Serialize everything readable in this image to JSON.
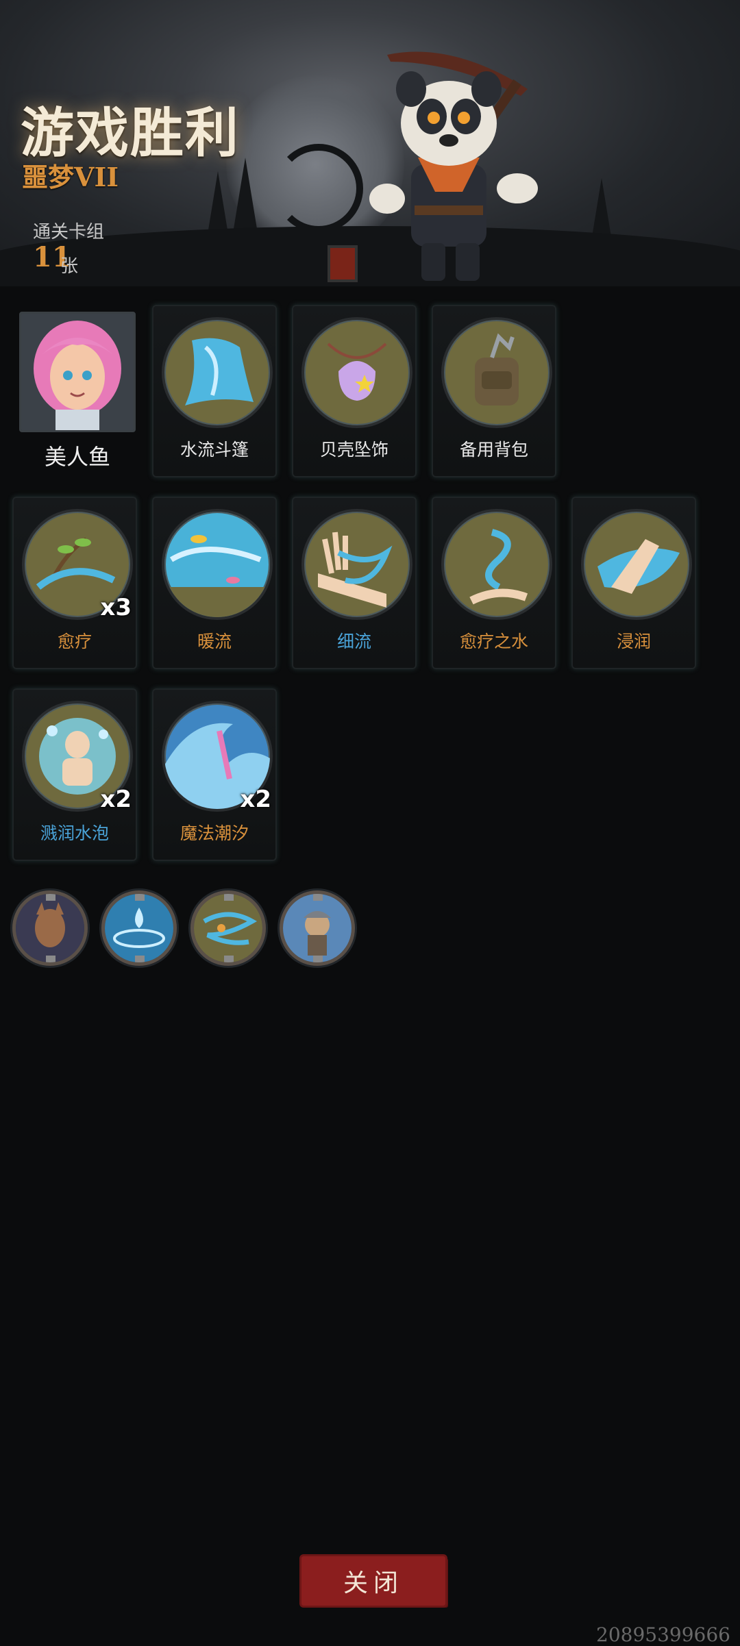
{
  "header": {
    "title": "游戏胜利",
    "difficulty": "噩梦VII",
    "deck_label": "通关卡组",
    "deck_count": "11",
    "deck_unit": "张"
  },
  "character": {
    "name": "美人鱼"
  },
  "equipment": [
    {
      "label": "水流斗篷",
      "icon": "water-cloak-icon"
    },
    {
      "label": "贝壳坠饰",
      "icon": "shell-pendant-icon"
    },
    {
      "label": "备用背包",
      "icon": "spare-backpack-icon"
    }
  ],
  "cards_row1": [
    {
      "label": "愈疗",
      "count": "x3",
      "color": "#d9913c",
      "icon": "heal-sapling-icon"
    },
    {
      "label": "暖流",
      "count": "",
      "color": "#d9913c",
      "icon": "warm-current-icon"
    },
    {
      "label": "细流",
      "count": "",
      "color": "#4aa3d8",
      "icon": "trickle-icon"
    },
    {
      "label": "愈疗之水",
      "count": "",
      "color": "#d9913c",
      "icon": "healing-water-icon"
    },
    {
      "label": "浸润",
      "count": "",
      "color": "#d9913c",
      "icon": "soak-icon"
    }
  ],
  "cards_row2": [
    {
      "label": "溅润水泡",
      "count": "x2",
      "color": "#4aa3d8",
      "icon": "bubble-icon"
    },
    {
      "label": "魔法潮汐",
      "count": "x2",
      "color": "#d9913c",
      "icon": "magic-tide-icon"
    }
  ],
  "relics": [
    {
      "icon": "fox-warrior-relic-icon"
    },
    {
      "icon": "water-drop-relic-icon"
    },
    {
      "icon": "whirlwind-relic-icon"
    },
    {
      "icon": "viking-relic-icon"
    }
  ],
  "close_label": "关闭",
  "watermark": "20895399666",
  "colors": {
    "accent": "#d9913c",
    "blue_text": "#4aa3d8",
    "close_button": "#8b1e1e"
  }
}
